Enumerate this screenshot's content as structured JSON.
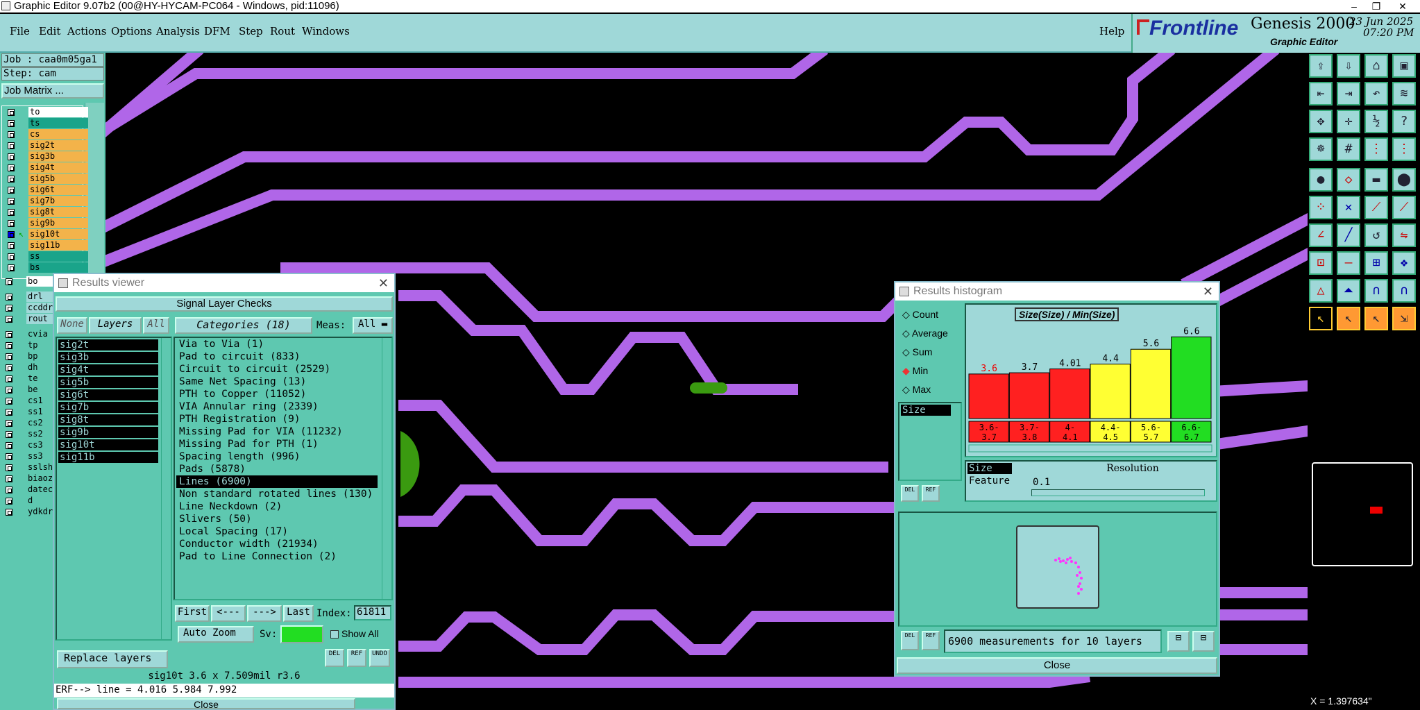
{
  "window": {
    "title": "Graphic Editor 9.07b2 (00@HY-HYCAM-PC064 - Windows, pid:11096)",
    "min": "–",
    "restore": "❐",
    "close": "✕"
  },
  "menu": [
    "File",
    "Edit",
    "Actions",
    "Options",
    "Analysis",
    "DFM",
    "Step",
    "Rout",
    "Windows"
  ],
  "help": "Help",
  "brand": {
    "logo": "Frontline",
    "product": "Genesis 2000",
    "sub": "Graphic Editor",
    "date": "23 Jun 2025",
    "time": "07:20 PM"
  },
  "left": {
    "job": "Job : caa0m05ga1",
    "step": "Step: cam",
    "matrix": "Job Matrix ...",
    "layers1": [
      {
        "n": "to",
        "c": "#ffffff"
      },
      {
        "n": "ts",
        "c": "#1aa48a"
      },
      {
        "n": "cs",
        "c": "#f3b34a"
      },
      {
        "n": "sig2t",
        "c": "#f3b34a"
      },
      {
        "n": "sig3b",
        "c": "#f3b34a"
      },
      {
        "n": "sig4t",
        "c": "#f3b34a"
      },
      {
        "n": "sig5b",
        "c": "#f3b34a"
      },
      {
        "n": "sig6t",
        "c": "#f3b34a"
      },
      {
        "n": "sig7b",
        "c": "#f3b34a"
      },
      {
        "n": "sig8t",
        "c": "#f3b34a"
      },
      {
        "n": "sig9b",
        "c": "#f3b34a"
      },
      {
        "n": "sig10t",
        "c": "#f3b34a"
      },
      {
        "n": "sig11b",
        "c": "#f3b34a"
      },
      {
        "n": "ss",
        "c": "#1aa48a"
      },
      {
        "n": "bs",
        "c": "#1aa48a"
      },
      {
        "n": "bo",
        "c": "#ffffff"
      }
    ],
    "layers2": [
      {
        "n": "drl",
        "c": "#9fd8d8"
      },
      {
        "n": "ccddr",
        "c": "#9fd8d8"
      },
      {
        "n": "rout",
        "c": "#9fd8d8"
      }
    ],
    "layers3": [
      "cvia",
      "tp",
      "bp",
      "dh",
      "te",
      "be",
      "cs1",
      "ss1",
      "cs2",
      "ss2",
      "cs3",
      "ss3",
      "sslsh",
      "biaoz",
      "datec",
      "d",
      "ydkdr"
    ]
  },
  "results_viewer": {
    "title": "Results viewer",
    "header": "Signal Layer Checks",
    "none": "None",
    "layers": "Layers",
    "all": "All",
    "categories": "Categories (18)",
    "meas_label": "Meas:",
    "meas_value": "All",
    "layer_list": [
      "sig2t",
      "sig3b",
      "sig4t",
      "sig5b",
      "sig6t",
      "sig7b",
      "sig8t",
      "sig9b",
      "sig10t",
      "sig11b"
    ],
    "cats": [
      "Via to Via (1)",
      "Pad to circuit (833)",
      "Circuit to circuit (2529)",
      "Same Net Spacing (13)",
      "PTH to Copper (11052)",
      "VIA Annular ring (2339)",
      "PTH Registration (9)",
      "Missing Pad for VIA (11232)",
      "Missing Pad for PTH (1)",
      "Spacing length (996)",
      "Pads (5878)",
      "Lines (6900)",
      "Non standard rotated lines (130)",
      "Line Neckdown (2)",
      "Slivers (50)",
      "Local Spacing (17)",
      "Conductor width (21934)",
      "Pad to Line Connection (2)"
    ],
    "selected_cat": "Lines (6900)",
    "first": "First",
    "prev": "<---",
    "next": "--->",
    "last": "Last",
    "index_label": "Index:",
    "index_value": "61811",
    "autozoom": "Auto Zoom",
    "sv": "Sv:",
    "showall": "Show All",
    "replace": "Replace layers",
    "del": "DEL",
    "ref": "REF",
    "undo": "UNDO",
    "info": "sig10t 3.6 x 7.509mil  r3.6",
    "erf": "ERF--> line = 4.016 5.984 7.992",
    "close": "Close"
  },
  "histogram": {
    "title": "Results histogram",
    "modes": [
      "Count",
      "Average",
      "Sum",
      "Min",
      "Max"
    ],
    "selected_mode": "Min",
    "field": "Size",
    "chart_title": "Size(Size) / Min(Size)",
    "measurements": "6900 measurements for 10 layers",
    "resolution_label": "Resolution",
    "resolution_value": "0.1",
    "size": "Size",
    "feature": "Feature",
    "close": "Close"
  },
  "chart_data": {
    "type": "bar",
    "title": "Size(Size) / Min(Size)",
    "categories": [
      "3.6-3.7",
      "3.7-3.8",
      "4-4.1",
      "4.4-4.5",
      "5.6-5.7",
      "6.6-6.7"
    ],
    "values": [
      3.6,
      3.7,
      4.01,
      4.4,
      5.6,
      6.6
    ],
    "value_labels": [
      "3.6",
      "3.7",
      "4.01",
      "4.4",
      "5.6",
      "6.6"
    ],
    "colors": [
      "#ff2020",
      "#ff2020",
      "#ff2020",
      "#ffff33",
      "#ffff33",
      "#22dd22"
    ],
    "ylim": [
      0,
      6.6
    ]
  },
  "status": {
    "x": "X = 1.397634\""
  },
  "colors": {
    "panel": "#5ec8b0",
    "light": "#9fd8d8",
    "trace": "#b066e8"
  }
}
